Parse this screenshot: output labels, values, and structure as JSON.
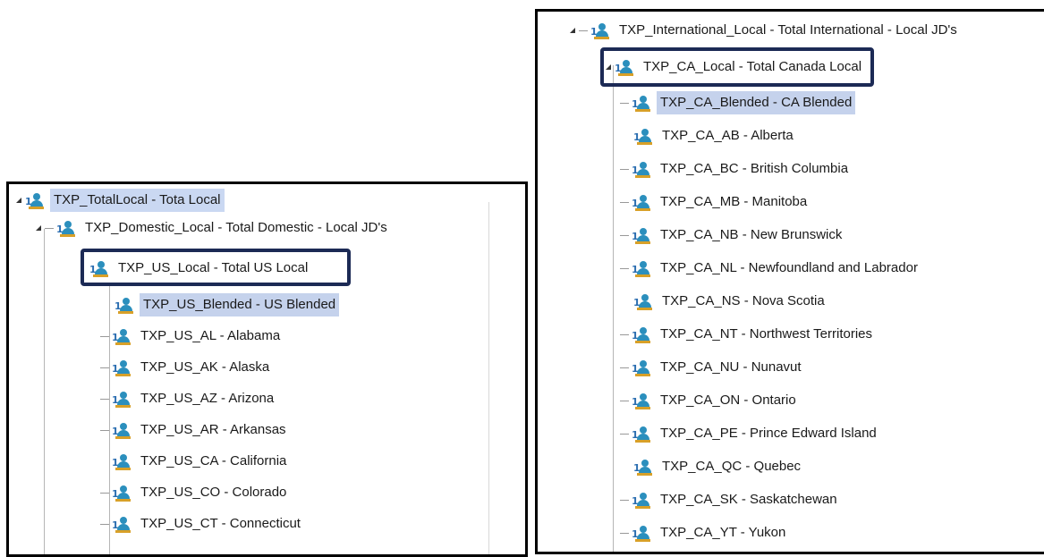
{
  "left_tree": {
    "rows": [
      {
        "text": "TXP_TotalLocal - Tota  Local",
        "state": "root"
      },
      {
        "text": "TXP_Domestic_Local - Total Domestic - Local JD's",
        "state": ""
      },
      {
        "text": "TXP_US_Local - Total US Local",
        "state": "boxed"
      },
      {
        "text": "TXP_US_Blended - US Blended",
        "state": "selected"
      },
      {
        "text": "TXP_US_AL - Alabama",
        "state": ""
      },
      {
        "text": "TXP_US_AK - Alaska",
        "state": ""
      },
      {
        "text": "TXP_US_AZ - Arizona",
        "state": ""
      },
      {
        "text": "TXP_US_AR - Arkansas",
        "state": ""
      },
      {
        "text": "TXP_US_CA - California",
        "state": ""
      },
      {
        "text": "TXP_US_CO - Colorado",
        "state": ""
      },
      {
        "text": "TXP_US_CT - Connecticut",
        "state": ""
      }
    ]
  },
  "right_tree": {
    "rows": [
      {
        "text": "TXP_International_Local - Total International - Local JD's",
        "state": ""
      },
      {
        "text": "TXP_CA_Local - Total Canada Local",
        "state": "boxed"
      },
      {
        "text": "TXP_CA_Blended - CA Blended",
        "state": "selected"
      },
      {
        "text": "TXP_CA_AB - Alberta",
        "state": ""
      },
      {
        "text": "TXP_CA_BC - British Columbia",
        "state": ""
      },
      {
        "text": "TXP_CA_MB - Manitoba",
        "state": ""
      },
      {
        "text": "TXP_CA_NB - New Brunswick",
        "state": ""
      },
      {
        "text": "TXP_CA_NL - Newfoundland and Labrador",
        "state": ""
      },
      {
        "text": "TXP_CA_NS - Nova Scotia",
        "state": ""
      },
      {
        "text": "TXP_CA_NT - Northwest Territories",
        "state": ""
      },
      {
        "text": "TXP_CA_NU - Nunavut",
        "state": ""
      },
      {
        "text": "TXP_CA_ON - Ontario",
        "state": ""
      },
      {
        "text": "TXP_CA_PE - Prince Edward Island",
        "state": ""
      },
      {
        "text": "TXP_CA_QC - Quebec",
        "state": ""
      },
      {
        "text": "TXP_CA_SK - Saskatchewan",
        "state": ""
      },
      {
        "text": "TXP_CA_YT - Yukon",
        "state": ""
      }
    ]
  },
  "colors": {
    "selection": "#c5d2ec",
    "highlight_box": "#1c2a55",
    "icon_person": "#2b8fbd",
    "icon_base": "#d8a028"
  },
  "icons": {
    "node": "user-group-icon",
    "expander": "tree-expand-icon"
  }
}
